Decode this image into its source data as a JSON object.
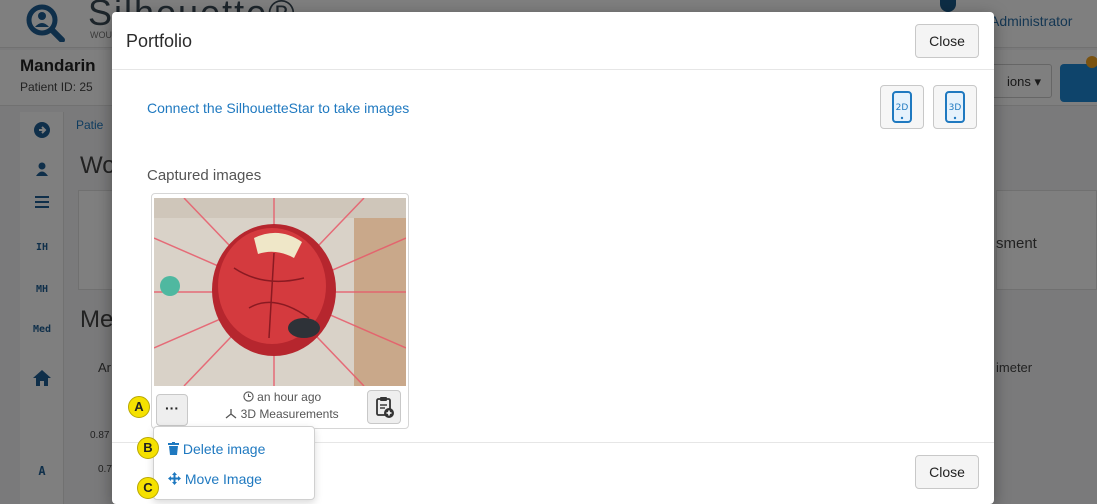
{
  "app": {
    "brand": "Silhouette®",
    "brand_sub": "WOUND",
    "user": "Administrator"
  },
  "patient": {
    "name": "Mandarin",
    "id_label": "Patient ID: 25",
    "options_label": "ions ▾"
  },
  "sidebar": {
    "items": [
      "IH",
      "MH",
      "Med",
      "A"
    ]
  },
  "background": {
    "breadcrumb": "Patie",
    "heading_wo": "Wo",
    "heading_me": "Me",
    "ar_label": "Ar",
    "assessment_label": "sment",
    "perimeter_label": "imeter",
    "axis_val_1": "0.87",
    "axis_val_2": "0.7"
  },
  "modal": {
    "title": "Portfolio",
    "close_top": "Close",
    "close_bottom": "Close",
    "connect_link": "Connect the SilhouetteStar to take images",
    "device_2d": "2D",
    "device_3d": "3D",
    "captured_label": "Captured images",
    "image": {
      "more_label": "···",
      "time": "an hour ago",
      "type": "3D Measurements"
    },
    "dropdown": {
      "delete_label": "Delete image",
      "move_label": "Move Image"
    }
  },
  "markers": {
    "a": "A",
    "b": "B",
    "c": "C"
  },
  "colors": {
    "accent": "#1f79c0",
    "marker": "#f5e100",
    "overlay": "rgba(0,0,0,0.5)"
  },
  "icons": [
    "search-person-icon",
    "clock-icon",
    "3d-axes-icon",
    "clipboard-add-icon",
    "trash-icon",
    "move-icon",
    "tablet-icon",
    "home-icon",
    "user-icon",
    "list-icon",
    "arrow-right-icon",
    "camera-icon"
  ]
}
